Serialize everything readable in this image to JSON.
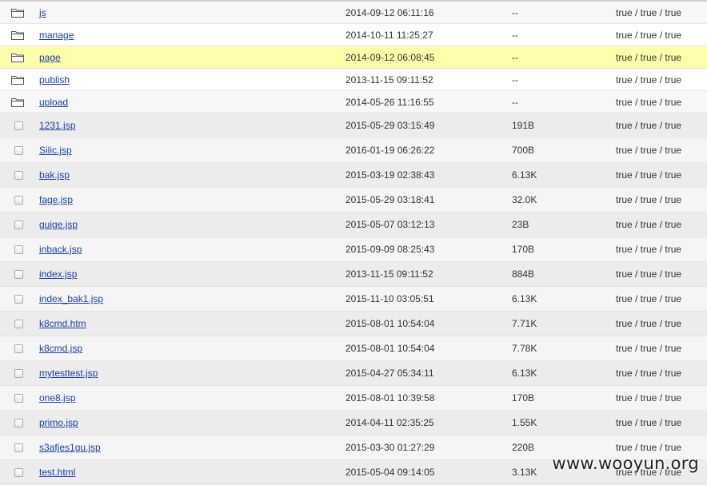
{
  "folders": [
    {
      "name": "js",
      "time": "2014-09-12 06:11:16",
      "size": "--",
      "perm": "true / true / true",
      "icon": "folder-icon"
    },
    {
      "name": "manage",
      "time": "2014-10-11 11:25:27",
      "size": "--",
      "perm": "true / true / true",
      "icon": "folder-icon"
    },
    {
      "name": "page",
      "time": "2014-09-12 06:08:45",
      "size": "--",
      "perm": "true / true / true",
      "icon": "folder-icon",
      "highlight": true
    },
    {
      "name": "publish",
      "time": "2013-11-15 09:11:52",
      "size": "--",
      "perm": "true / true / true",
      "icon": "folder-icon"
    },
    {
      "name": "upload",
      "time": "2014-05-26 11:16:55",
      "size": "--",
      "perm": "true / true / true",
      "icon": "folder-icon"
    }
  ],
  "files": [
    {
      "name": "1231.jsp",
      "time": "2015-05-29 03:15:49",
      "size": "191B",
      "perm": "true / true / true"
    },
    {
      "name": "Silic.jsp",
      "time": "2016-01-19 06:26:22",
      "size": "700B",
      "perm": "true / true / true"
    },
    {
      "name": "bak.jsp",
      "time": "2015-03-19 02:38:43",
      "size": "6.13K",
      "perm": "true / true / true"
    },
    {
      "name": "fage.jsp",
      "time": "2015-05-29 03:18:41",
      "size": "32.0K",
      "perm": "true / true / true"
    },
    {
      "name": "guige.jsp",
      "time": "2015-05-07 03:12:13",
      "size": "23B",
      "perm": "true / true / true"
    },
    {
      "name": "inback.jsp",
      "time": "2015-09-09 08:25:43",
      "size": "170B",
      "perm": "true / true / true"
    },
    {
      "name": "index.jsp",
      "time": "2013-11-15 09:11:52",
      "size": "884B",
      "perm": "true / true / true"
    },
    {
      "name": "index_bak1.jsp",
      "time": "2015-11-10 03:05:51",
      "size": "6.13K",
      "perm": "true / true / true"
    },
    {
      "name": "k8cmd.htm",
      "time": "2015-08-01 10:54:04",
      "size": "7.71K",
      "perm": "true / true / true"
    },
    {
      "name": "k8cmd.jsp",
      "time": "2015-08-01 10:54:04",
      "size": "7.78K",
      "perm": "true / true / true"
    },
    {
      "name": "mytesttest.jsp",
      "time": "2015-04-27 05:34:11",
      "size": "6.13K",
      "perm": "true / true / true"
    },
    {
      "name": "one8.jsp",
      "time": "2015-08-01 10:39:58",
      "size": "170B",
      "perm": "true / true / true"
    },
    {
      "name": "primo.jsp",
      "time": "2014-04-11 02:35:25",
      "size": "1.55K",
      "perm": "true / true / true"
    },
    {
      "name": "s3afjes1gu.jsp",
      "time": "2015-03-30 01:27:29",
      "size": "220B",
      "perm": "true / true / true"
    },
    {
      "name": "test.html",
      "time": "2015-05-04 09:14:05",
      "size": "3.13K",
      "perm": "true / true / true"
    }
  ],
  "colors": {
    "highlight": "#ffffaa",
    "link": "#1a3fa8"
  },
  "watermark": "www.wooyun.org"
}
